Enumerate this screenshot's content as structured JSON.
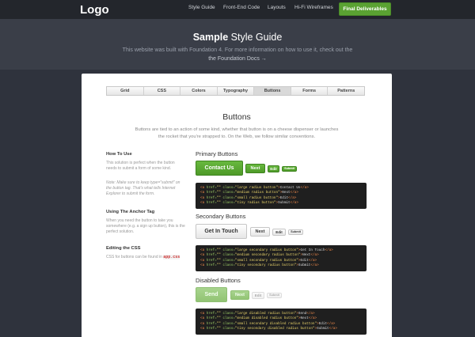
{
  "topbar": {
    "logo": "Logo",
    "nav": [
      "Style Guide",
      "Front-End Code",
      "Layouts",
      "Hi-Fi Wireframes"
    ],
    "final_button": "Final Deliverables"
  },
  "hero": {
    "title_bold": "Sample",
    "title_rest": " Style Guide",
    "text": "This website was built with Foundation 4. For more information on how to use it, check out the",
    "link": "the Foundation Docs →"
  },
  "tabs": [
    "Grid",
    "CSS",
    "Colors",
    "Typography",
    "Buttons",
    "Forms",
    "Patterns"
  ],
  "active_tab": "Buttons",
  "page": {
    "title": "Buttons",
    "description": "Buttons are tied to an action of some kind, whether that button is on a cheese dispenser or launches the rocket that you're strapped to. On the Web, we follow similar conventions."
  },
  "sidebar": {
    "how_to_use_h": "How To Use",
    "how_to_use_p": "This solution is perfect when the button needs to submit a form of some kind.",
    "note_p": "Note: Make sure to keep type=\"submit\" on the button tag. That's what tells Internet Explorer to submit the form.",
    "anchor_h": "Using The Anchor Tag",
    "anchor_p": "When you need the button to take you somewhere (e.g. a sign up button), this is the perfect solution.",
    "css_h": "Editing the CSS",
    "css_p": "CSS for buttons can be found in",
    "css_file": "app.css"
  },
  "primary": {
    "heading": "Primary Buttons",
    "large": "Contact Us",
    "medium": "Next",
    "small": "Edit",
    "tiny": "Submit",
    "code": [
      [
        "large radius button",
        "Contact Us"
      ],
      [
        "medium radius button",
        "Next"
      ],
      [
        "small radius button",
        "Edit"
      ],
      [
        "tiny radius button",
        "Submit"
      ]
    ]
  },
  "secondary": {
    "heading": "Secondary Buttons",
    "large": "Get In Touch",
    "medium": "Next",
    "small": "Edit",
    "tiny": "Submit",
    "code": [
      [
        "large secondary radius button",
        "Get In Touch"
      ],
      [
        "medium secondary radius button",
        "Next"
      ],
      [
        "small secondary radius button",
        "Edit"
      ],
      [
        "tiny secondary radius button",
        "Submit"
      ]
    ]
  },
  "disabled": {
    "heading": "Disabled Buttons",
    "large": "Send",
    "medium": "Next",
    "small": "Edit",
    "tiny": "Submit",
    "code": [
      [
        "large disabled radius button",
        "Send"
      ],
      [
        "medium disabled radius button",
        "Next"
      ],
      [
        "small secondary disabled radius button",
        "Edit"
      ],
      [
        "tiny secondary disabled radius button",
        "Submit"
      ]
    ]
  },
  "colors": {
    "accent": "#5aa232",
    "dark": "#23262c",
    "hero": "#3a3e48"
  }
}
